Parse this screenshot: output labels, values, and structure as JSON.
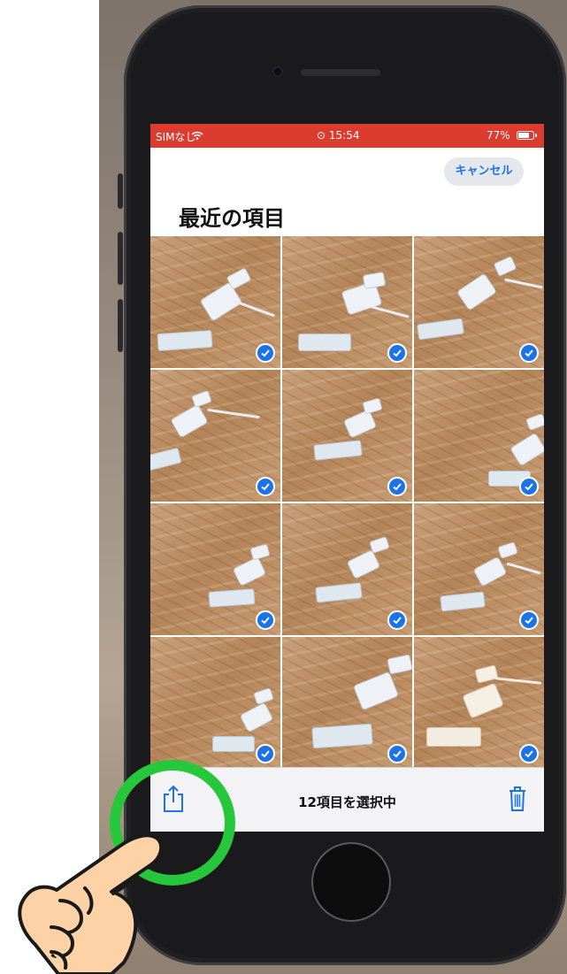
{
  "status_bar": {
    "carrier": "SIMなし",
    "time": "15:54",
    "battery": "77%",
    "wifi_icon": "wifi-icon",
    "battery_icon": "battery-icon"
  },
  "header": {
    "cancel_label": "キャンセル",
    "title": "最近の項目"
  },
  "grid": {
    "rows": 4,
    "columns": 3,
    "photos_selected": 12
  },
  "toolbar": {
    "selection_label": "12項目を選択中",
    "share_icon": "share-icon",
    "trash_icon": "trash-icon"
  },
  "colors": {
    "status_bar": "#dc3b30",
    "accent": "#1a73e8",
    "highlight_ring": "#27c73b"
  }
}
